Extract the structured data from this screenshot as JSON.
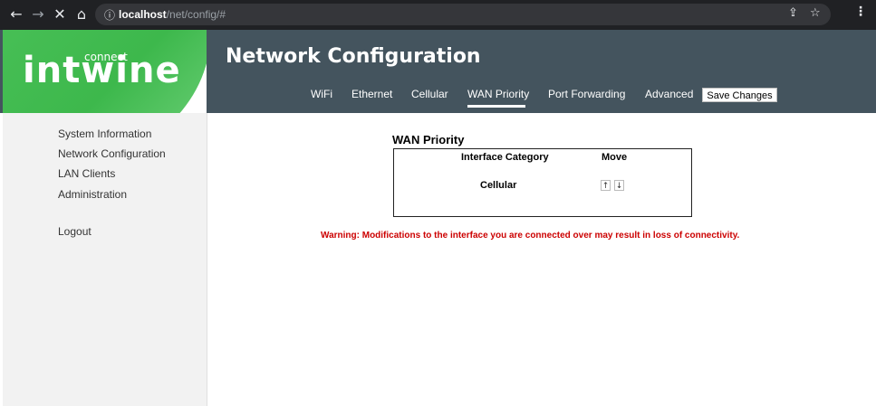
{
  "browser": {
    "back_icon": "←",
    "forward_icon": "→",
    "stop_icon": "✕",
    "home_icon": "⌂",
    "info_icon": "ⓘ",
    "url_host": "localhost",
    "url_path": "/net/config/#",
    "share_icon": "⇪",
    "star_icon": "☆",
    "menu_icon": "⋮"
  },
  "logo": {
    "main": "intwine",
    "sub": "connect"
  },
  "header": {
    "title": "Network Configuration",
    "tabs": [
      {
        "label": "WiFi"
      },
      {
        "label": "Ethernet"
      },
      {
        "label": "Cellular"
      },
      {
        "label": "WAN Priority",
        "active": true
      },
      {
        "label": "Port Forwarding"
      },
      {
        "label": "Advanced"
      }
    ],
    "save_label": "Save Changes"
  },
  "sidebar": {
    "items": [
      {
        "label": "System Information"
      },
      {
        "label": "Network Configuration"
      },
      {
        "label": "LAN Clients"
      },
      {
        "label": "Administration"
      },
      {
        "label": "Logout"
      }
    ]
  },
  "wan_priority": {
    "title": "WAN Priority",
    "col_interface": "Interface Category",
    "col_move": "Move",
    "rows": [
      {
        "interface": "Cellular",
        "up": "↑",
        "down": "↓"
      }
    ]
  },
  "warning": "Warning: Modifications to the interface you are connected over may result in loss of connectivity.",
  "colors": {
    "header_bg": "#44545e",
    "brand_green": "#3db84c",
    "warning_red": "#cc0000"
  }
}
